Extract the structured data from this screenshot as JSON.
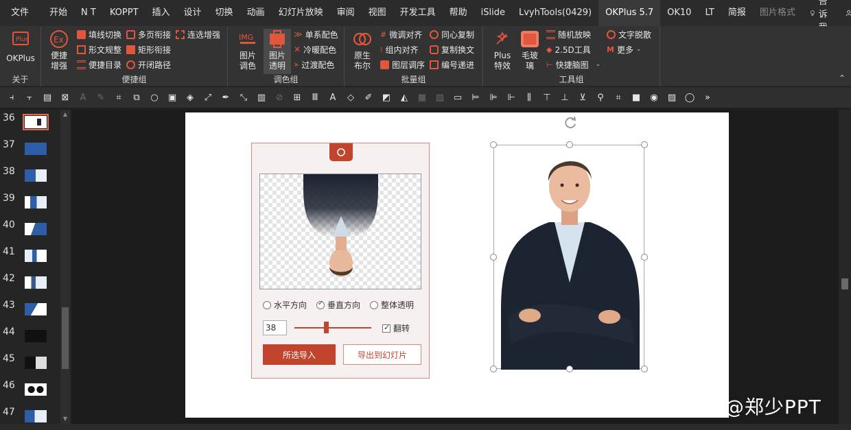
{
  "menubar": {
    "items": [
      "文件",
      "开始",
      "N T",
      "KOPPT",
      "插入",
      "设计",
      "切换",
      "动画",
      "幻灯片放映",
      "审阅",
      "视图",
      "开发工具",
      "帮助",
      "iSlide",
      "LvyhTools(0429)",
      "OKPlus 5.7",
      "OK10",
      "LT",
      "简报",
      "图片格式"
    ],
    "active_index": 15,
    "tell_me": "告诉我",
    "share": "共享"
  },
  "ribbon": {
    "groups": [
      {
        "label": "关于",
        "big": [
          {
            "label": "OKPlus"
          }
        ]
      },
      {
        "label": "便捷组",
        "big": [
          {
            "label": "便捷增强"
          }
        ],
        "small": [
          "填线切换",
          "形文规整",
          "便捷目录",
          "多页衔接",
          "矩形衔接",
          "开闭路径",
          "连选增强"
        ]
      },
      {
        "label": "调色组",
        "big": [
          {
            "label": "图片调色"
          },
          {
            "label": "图片透明"
          }
        ],
        "small": [
          "单系配色",
          "冷暖配色",
          "过渡配色"
        ]
      },
      {
        "label": "批量组",
        "big": [
          {
            "label": "原生布尔"
          }
        ],
        "small": [
          "微调对齐",
          "组内对齐",
          "图层调序",
          "同心复制",
          "复制换文",
          "编号递进"
        ]
      },
      {
        "label": "工具组",
        "big": [
          {
            "label": "Plus特效"
          },
          {
            "label": "毛玻璃"
          }
        ],
        "small": [
          "随机放映",
          "2.5D工具",
          "快捷脑图",
          "文字脱散",
          "更多"
        ]
      }
    ]
  },
  "thumbnails": {
    "numbers": [
      "36",
      "37",
      "38",
      "39",
      "40",
      "41",
      "42",
      "43",
      "44",
      "45",
      "46",
      "47"
    ],
    "selected": "36"
  },
  "panel": {
    "options": [
      "水平方向",
      "垂直方向",
      "整体透明"
    ],
    "selected_option": "垂直方向",
    "value": "38",
    "slider_fraction": 0.38,
    "flip_label": "翻转",
    "flip_checked": true,
    "import_button": "所选导入",
    "export_button": "导出到幻灯片"
  },
  "watermark": "头条 @郑少PPT",
  "colors": {
    "accent": "#c0452c",
    "panel_border": "#d98a76",
    "ribbon": "#333333",
    "menubar": "#2b2b2b"
  }
}
